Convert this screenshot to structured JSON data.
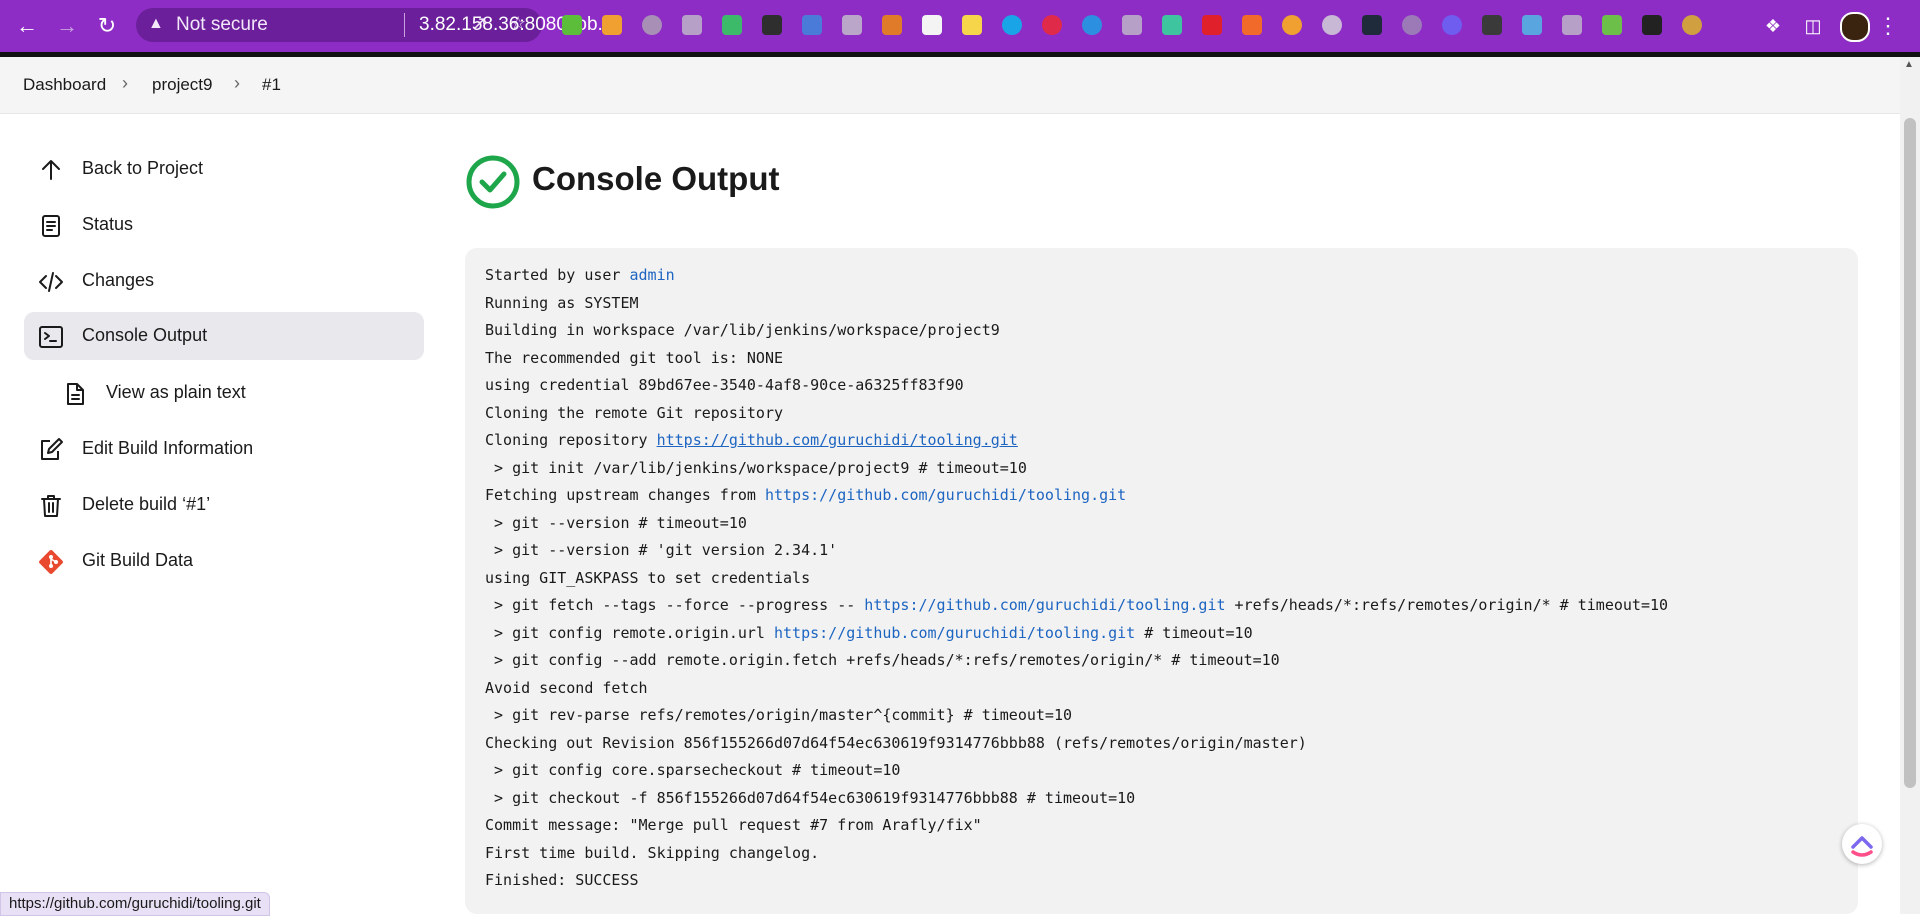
{
  "browser": {
    "security_label": "Not secure",
    "url": "3.82.158.36:8080/job..."
  },
  "breadcrumb": [
    {
      "label": "Dashboard"
    },
    {
      "label": "project9"
    },
    {
      "label": "#1"
    }
  ],
  "sidebar": {
    "items": [
      {
        "label": "Back to Project",
        "icon": "arrow-up-icon"
      },
      {
        "label": "Status",
        "icon": "document-icon"
      },
      {
        "label": "Changes",
        "icon": "code-icon"
      },
      {
        "label": "Console Output",
        "icon": "terminal-icon",
        "active": true
      },
      {
        "label": "View as plain text",
        "icon": "file-text-icon"
      },
      {
        "label": "Edit Build Information",
        "icon": "edit-icon"
      },
      {
        "label": "Delete build ‘#1’",
        "icon": "trash-icon"
      },
      {
        "label": "Git Build Data",
        "icon": "git-icon"
      }
    ]
  },
  "main": {
    "title": "Console Output",
    "status_color": "#1ea64b",
    "lines": [
      {
        "segments": [
          {
            "text": "Started by user "
          },
          {
            "text": "admin",
            "link": true
          }
        ]
      },
      {
        "segments": [
          {
            "text": "Running as SYSTEM"
          }
        ]
      },
      {
        "segments": [
          {
            "text": "Building in workspace /var/lib/jenkins/workspace/project9"
          }
        ]
      },
      {
        "segments": [
          {
            "text": "The recommended git tool is: NONE"
          }
        ]
      },
      {
        "segments": [
          {
            "text": "using credential 89bd67ee-3540-4af8-90ce-a6325ff83f90"
          }
        ]
      },
      {
        "segments": [
          {
            "text": "Cloning the remote Git repository"
          }
        ]
      },
      {
        "segments": [
          {
            "text": "Cloning repository "
          },
          {
            "text": "https://github.com/guruchidi/tooling.git",
            "link": true,
            "underline": true
          }
        ]
      },
      {
        "segments": [
          {
            "text": " > git init /var/lib/jenkins/workspace/project9 # timeout=10"
          }
        ]
      },
      {
        "segments": [
          {
            "text": "Fetching upstream changes from "
          },
          {
            "text": "https://github.com/guruchidi/tooling.git",
            "link": true
          }
        ]
      },
      {
        "segments": [
          {
            "text": " > git --version # timeout=10"
          }
        ]
      },
      {
        "segments": [
          {
            "text": " > git --version # 'git version 2.34.1'"
          }
        ]
      },
      {
        "segments": [
          {
            "text": "using GIT_ASKPASS to set credentials"
          }
        ]
      },
      {
        "segments": [
          {
            "text": " > git fetch --tags --force --progress -- "
          },
          {
            "text": "https://github.com/guruchidi/tooling.git",
            "link": true
          },
          {
            "text": " +refs/heads/*:refs/remotes/origin/* # timeout=10"
          }
        ]
      },
      {
        "segments": [
          {
            "text": " > git config remote.origin.url "
          },
          {
            "text": "https://github.com/guruchidi/tooling.git",
            "link": true
          },
          {
            "text": " # timeout=10"
          }
        ]
      },
      {
        "segments": [
          {
            "text": " > git config --add remote.origin.fetch +refs/heads/*:refs/remotes/origin/* # timeout=10"
          }
        ]
      },
      {
        "segments": [
          {
            "text": "Avoid second fetch"
          }
        ]
      },
      {
        "segments": [
          {
            "text": " > git rev-parse refs/remotes/origin/master^{commit} # timeout=10"
          }
        ]
      },
      {
        "segments": [
          {
            "text": "Checking out Revision 856f155266d07d64f54ec630619f9314776bbb88 (refs/remotes/origin/master)"
          }
        ]
      },
      {
        "segments": [
          {
            "text": " > git config core.sparsecheckout # timeout=10"
          }
        ]
      },
      {
        "segments": [
          {
            "text": " > git checkout -f 856f155266d07d64f54ec630619f9314776bbb88 # timeout=10"
          }
        ]
      },
      {
        "segments": [
          {
            "text": "Commit message: \"Merge pull request #7 from Arafly/fix\""
          }
        ]
      },
      {
        "segments": [
          {
            "text": "First time build. Skipping changelog."
          }
        ]
      },
      {
        "segments": [
          {
            "text": "Finished: SUCCESS"
          }
        ]
      }
    ]
  },
  "statusbar": {
    "url": "https://github.com/guruchidi/tooling.git"
  }
}
